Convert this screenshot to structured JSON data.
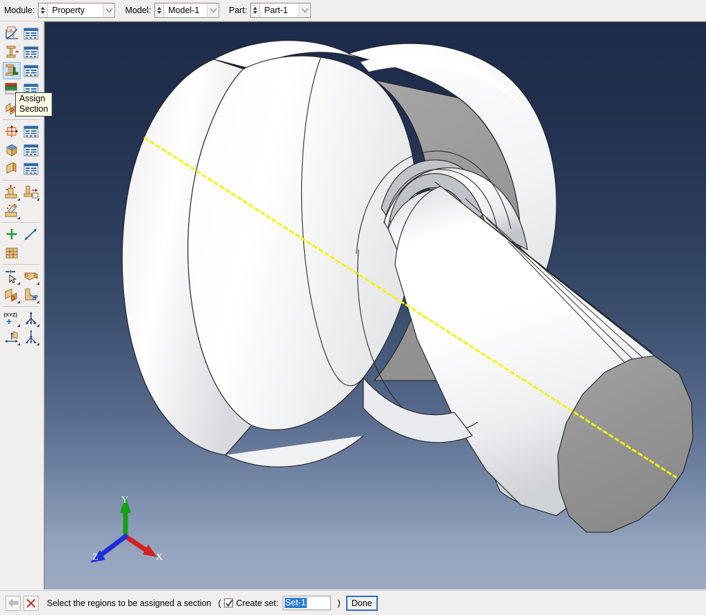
{
  "app": {
    "name": "Abaqus/CAE",
    "window_bg": "#f0efee"
  },
  "context_bar": {
    "module": {
      "label": "Module:",
      "value": "Property",
      "name": "module-combo"
    },
    "model": {
      "label": "Model:",
      "value": "Model-1",
      "name": "model-combo"
    },
    "part": {
      "label": "Part:",
      "value": "Part-1",
      "name": "part-combo"
    }
  },
  "tooltip": {
    "line1": "Assign",
    "line2": "Section",
    "bg": "#fdfbe4",
    "border": "#3a3a3a"
  },
  "toolbox": {
    "rows": [
      {
        "cells": [
          {
            "icon": "create-material-icon",
            "selected": false,
            "flyout": false
          },
          {
            "icon": "material-manager-icon",
            "selected": false,
            "flyout": false
          }
        ]
      },
      {
        "cells": [
          {
            "icon": "create-section-icon",
            "selected": false,
            "flyout": false
          },
          {
            "icon": "section-manager-icon",
            "selected": false,
            "flyout": false
          }
        ]
      },
      {
        "cells": [
          {
            "icon": "assign-section-icon",
            "selected": true,
            "flyout": false
          },
          {
            "icon": "section-assignment-manager-icon",
            "selected": false,
            "flyout": false
          }
        ]
      },
      {
        "cells": [
          {
            "icon": "assign-beam-orientation-icon",
            "selected": false,
            "flyout": true
          },
          {
            "icon": "beam-orientation-manager-icon",
            "selected": false,
            "flyout": false
          }
        ]
      },
      {
        "cells": [
          {
            "icon": "assign-material-orientation-icon",
            "selected": false,
            "flyout": true
          },
          {
            "icon": "material-orientation-manager-icon",
            "selected": false,
            "flyout": false
          }
        ]
      },
      {
        "cells": [
          {
            "icon": "create-skin-icon",
            "selected": false,
            "flyout": false
          },
          {
            "icon": "skin-manager-icon",
            "selected": false,
            "flyout": false
          }
        ]
      },
      {
        "cells": [
          {
            "icon": "create-stringer-icon",
            "selected": false,
            "flyout": false
          },
          {
            "icon": "stringer-manager-icon",
            "selected": false,
            "flyout": false
          }
        ]
      },
      {
        "cells": [
          {
            "icon": "create-inertia-icon",
            "selected": false,
            "flyout": true
          },
          {
            "icon": "assign-inertia-icon",
            "selected": false,
            "flyout": true
          }
        ]
      },
      {
        "cells": [
          {
            "icon": "edit-inertia-icon",
            "selected": false,
            "flyout": true
          }
        ]
      },
      {
        "cells": [
          {
            "icon": "create-datum-point-icon",
            "selected": false,
            "flyout": false
          },
          {
            "icon": "create-datum-axis-icon",
            "selected": false,
            "flyout": false
          }
        ]
      },
      {
        "cells": [
          {
            "icon": "create-datum-csys-icon",
            "selected": false,
            "flyout": false
          }
        ]
      },
      {
        "cells": [
          {
            "icon": "partition-select-icon",
            "selected": false,
            "flyout": true
          },
          {
            "icon": "partition-edge-icon",
            "selected": false,
            "flyout": true
          }
        ]
      },
      {
        "cells": [
          {
            "icon": "partition-face-icon",
            "selected": false,
            "flyout": true
          },
          {
            "icon": "partition-cell-icon",
            "selected": false,
            "flyout": true
          }
        ]
      },
      {
        "cells": [
          {
            "icon": "query-xyz-icon",
            "selected": false,
            "flyout": true
          },
          {
            "icon": "set-display-icon",
            "selected": false,
            "flyout": true
          }
        ]
      },
      {
        "cells": [
          {
            "icon": "surface-display-icon",
            "selected": false,
            "flyout": true
          },
          {
            "icon": "attribute-display-icon",
            "selected": false,
            "flyout": true
          }
        ]
      }
    ],
    "separators_after_row": [
      6,
      8,
      10,
      12
    ]
  },
  "viewport": {
    "bg_top": "#1d2b4a",
    "bg_bottom": "#9cabc2",
    "model": {
      "name": "flanged-shaft-part",
      "face_light": "#f4f5f6",
      "face_mid": "#e2e4e6",
      "face_dark": "#9c9c9c",
      "edge_color": "#1f1f1f",
      "axis_color": "#f2f20c",
      "axis_style": "dash-dot"
    },
    "triad": {
      "name": "orientation-triad",
      "x_label": "X",
      "y_label": "Y",
      "z_label": "Z",
      "x_color": "#d42020",
      "y_color": "#15a015",
      "z_color": "#1f2fd8",
      "label_color": "#ffffff"
    }
  },
  "prompt_bar": {
    "back_icon": "back-arrow-icon",
    "cancel_icon": "cancel-x-icon",
    "message": "Select the regions to be assigned a section",
    "open_paren": "(",
    "close_paren": ")",
    "create_set": {
      "label": "Create set:",
      "checked": true,
      "value": "Set-1"
    },
    "done_label": "Done",
    "done_focus_color": "#2f6fb5",
    "selection_highlight": "#2f7fd1"
  }
}
